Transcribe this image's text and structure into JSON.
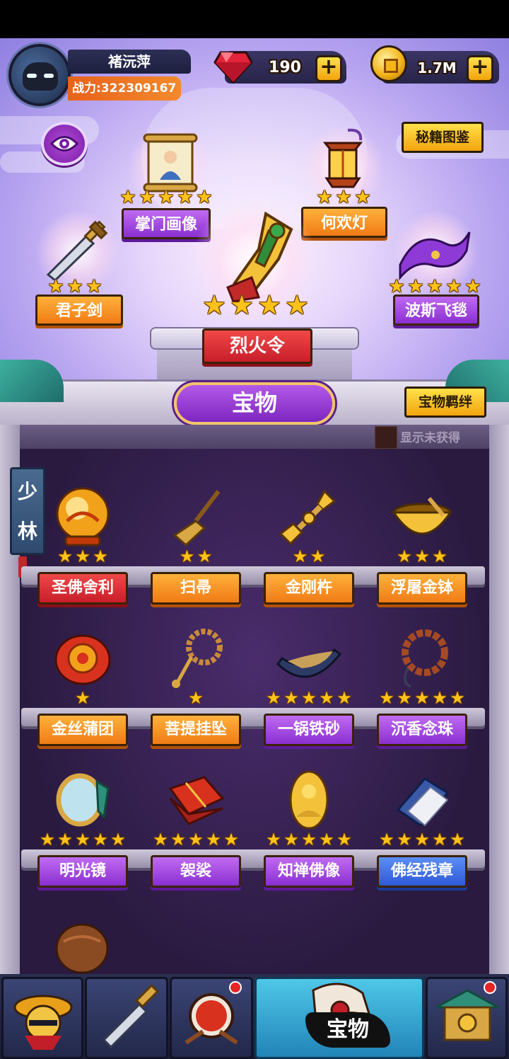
{
  "player": {
    "name": "褚沅萍",
    "power_text": "战力:322309167"
  },
  "currency": {
    "gems": "190",
    "coins": "1.7M",
    "plus_symbol": "+"
  },
  "buttons": {
    "secret_catalog": "秘籍图鉴",
    "treasure_bond": "宝物羁绊",
    "show_unobtained": "显示未获得"
  },
  "featured": {
    "center": {
      "name": "烈火令",
      "stars": 4
    },
    "items": [
      {
        "name": "掌门画像",
        "stars": 5
      },
      {
        "name": "何欢灯",
        "stars": 3
      },
      {
        "name": "君子剑",
        "stars": 3
      },
      {
        "name": "波斯飞毯",
        "stars": 5
      }
    ]
  },
  "section_title": "宝物",
  "sect": {
    "char1": "少",
    "char2": "林"
  },
  "treasures": [
    {
      "name": "圣佛舍利",
      "stars": 3,
      "color": "red"
    },
    {
      "name": "扫帚",
      "stars": 2,
      "color": "orange"
    },
    {
      "name": "金刚杵",
      "stars": 2,
      "color": "orange"
    },
    {
      "name": "浮屠金钵",
      "stars": 3,
      "color": "orange"
    },
    {
      "name": "金丝蒲团",
      "stars": 1,
      "color": "orange"
    },
    {
      "name": "菩提挂坠",
      "stars": 1,
      "color": "orange"
    },
    {
      "name": "一锅铁砂",
      "stars": 5,
      "color": "purple"
    },
    {
      "name": "沉香念珠",
      "stars": 5,
      "color": "purple"
    },
    {
      "name": "明光镜",
      "stars": 5,
      "color": "purple"
    },
    {
      "name": "袈裟",
      "stars": 5,
      "color": "purple"
    },
    {
      "name": "知禅佛像",
      "stars": 5,
      "color": "purple"
    },
    {
      "name": "佛经残章",
      "stars": 5,
      "color": "blue"
    }
  ],
  "nav": {
    "active_label": "宝物",
    "tabs": [
      "hero-tab",
      "weapon-tab",
      "drum-tab",
      "treasure-tab",
      "shop-tab"
    ]
  },
  "colors": {
    "gold": "#f2a40d",
    "purple_plate": "#8a2fd1",
    "orange_plate": "#f07b16",
    "red_plate": "#c81e2a",
    "blue_plate": "#2f59d6"
  }
}
